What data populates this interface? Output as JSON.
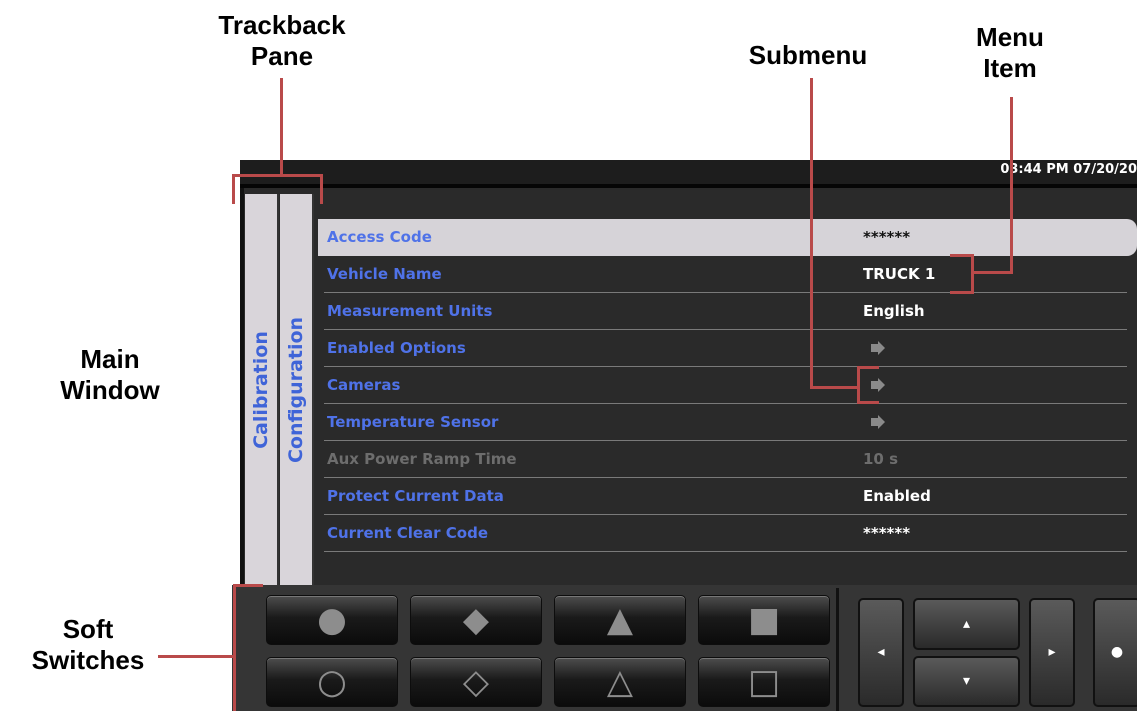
{
  "callouts": {
    "trackback_pane_line1": "Trackback",
    "trackback_pane_line2": "Pane",
    "submenu": "Submenu",
    "menu_item_line1": "Menu",
    "menu_item_line2": "Item",
    "main_window_line1": "Main",
    "main_window_line2": "Window",
    "soft_switches_line1": "Soft",
    "soft_switches_line2": "Switches"
  },
  "status": {
    "clock": "03:44 PM 07/20/20"
  },
  "trackback": {
    "tabs": [
      {
        "label": "Calibration"
      },
      {
        "label": "Configuration"
      }
    ]
  },
  "menu": {
    "rows": [
      {
        "label": "Access Code",
        "value": "******",
        "selected": true
      },
      {
        "label": "Vehicle Name",
        "value": "TRUCK 1"
      },
      {
        "label": "Measurement Units",
        "value": "English"
      },
      {
        "label": "Enabled Options",
        "submenu": true
      },
      {
        "label": "Cameras",
        "submenu": true
      },
      {
        "label": "Temperature Sensor",
        "submenu": true
      },
      {
        "label": "Aux Power Ramp Time",
        "value": "10 s",
        "disabled": true
      },
      {
        "label": "Protect Current Data",
        "value": "Enabled"
      },
      {
        "label": "Current Clear Code",
        "value": "******"
      }
    ]
  },
  "soft_switches": {
    "top": [
      {
        "name": "filled-circle-icon",
        "glyph": "●"
      },
      {
        "name": "filled-diamond-icon",
        "glyph": "◆"
      },
      {
        "name": "filled-triangle-icon",
        "glyph": "▲"
      },
      {
        "name": "filled-square-icon",
        "glyph": "■"
      }
    ],
    "bottom": [
      {
        "name": "outline-circle-icon",
        "glyph": "○"
      },
      {
        "name": "outline-diamond-icon",
        "glyph": "◇"
      },
      {
        "name": "outline-triangle-icon",
        "glyph": "△"
      },
      {
        "name": "outline-square-icon",
        "glyph": "□"
      }
    ]
  },
  "nav": {
    "left": "◂",
    "up": "▴",
    "down": "▾",
    "right": "▸",
    "select": "●"
  },
  "colors": {
    "callout_line": "#b94a4a",
    "label_blue": "#4f72e8",
    "selected_bg": "#d6d3d8"
  }
}
